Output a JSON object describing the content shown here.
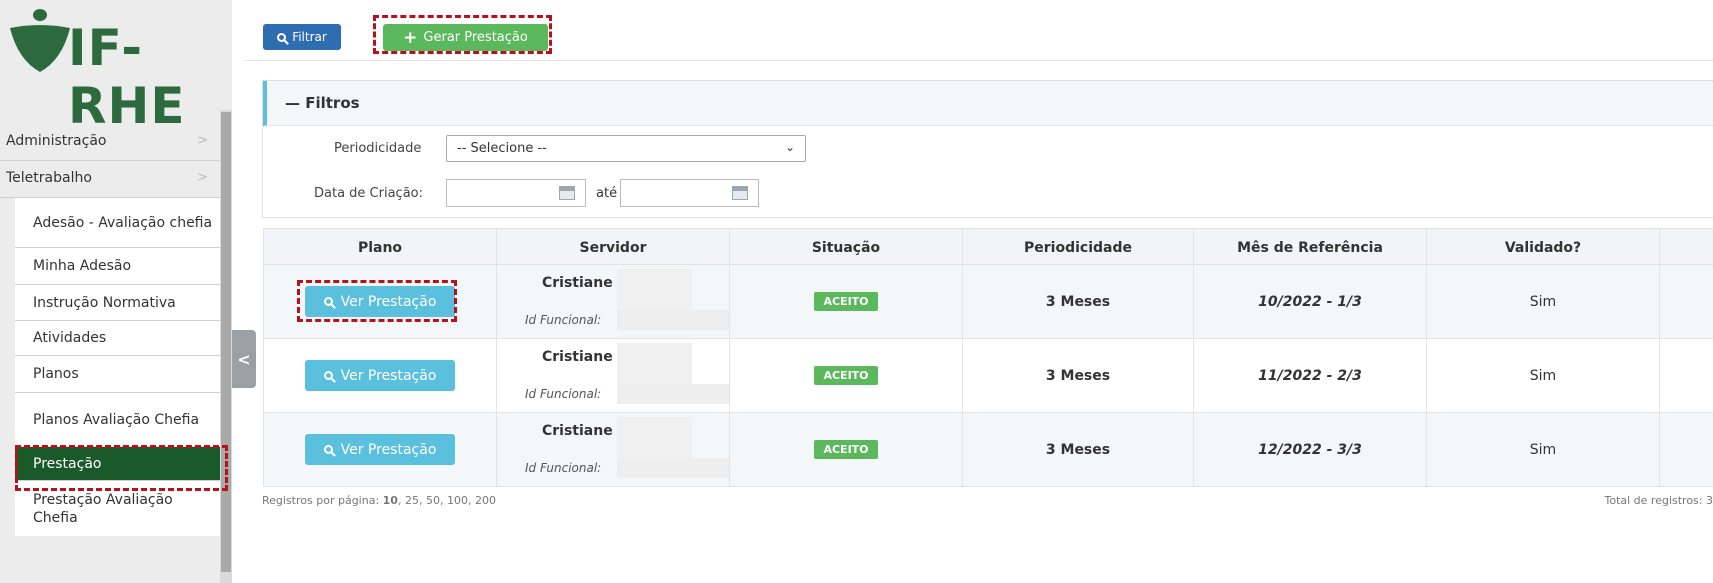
{
  "app": {
    "logo_text": "IF-RHE"
  },
  "sidebar": {
    "top_items": [
      {
        "label": "Administração",
        "chevron": ">"
      },
      {
        "label": "Teletrabalho",
        "chevron": ">"
      }
    ],
    "sub_items": [
      {
        "label": "Adesão - Avaliação chefia"
      },
      {
        "label": "Minha Adesão"
      },
      {
        "label": "Instrução Normativa"
      },
      {
        "label": "Atividades"
      },
      {
        "label": "Planos"
      },
      {
        "label": "Planos Avaliação Chefia"
      },
      {
        "label": "Prestação"
      },
      {
        "label": "Prestação Avaliação Chefia"
      }
    ],
    "collapse_glyph": "<"
  },
  "toolbar": {
    "filter_label": "Filtrar",
    "generate_label": "Gerar Prestação",
    "plus_glyph": "+"
  },
  "filters": {
    "title": "Filtros",
    "collapse_glyph": "—",
    "periodicity_label": "Periodicidade",
    "periodicity_value": "-- Selecione --",
    "creation_date_label": "Data de Criação:",
    "until_label": "até",
    "date_from": "",
    "date_to": ""
  },
  "table": {
    "columns": [
      "Plano",
      "Servidor",
      "Situação",
      "Periodicidade",
      "Mês de Referência",
      "Validado?"
    ],
    "rows": [
      {
        "action": "Ver Prestação",
        "server_name": "Cristiane",
        "server_id_label": "Id Funcional:",
        "status": "ACEITO",
        "periodicity": "3 Meses",
        "month": "10/2022 - 1/3",
        "validated": "Sim"
      },
      {
        "action": "Ver Prestação",
        "server_name": "Cristiane",
        "server_id_label": "Id Funcional:",
        "status": "ACEITO",
        "periodicity": "3 Meses",
        "month": "11/2022 - 2/3",
        "validated": "Sim"
      },
      {
        "action": "Ver Prestação",
        "server_name": "Cristiane",
        "server_id_label": "Id Funcional:",
        "status": "ACEITO",
        "periodicity": "3 Meses",
        "month": "12/2022 - 3/3",
        "validated": "Sim"
      }
    ]
  },
  "footer": {
    "per_page_prefix": "Registros por página:",
    "per_page_options": [
      "10",
      "25",
      "50",
      "100",
      "200"
    ],
    "per_page_selected": "10",
    "total_label": "Total de registros: 3"
  },
  "colors": {
    "brand_green": "#2d6a3e",
    "active_item": "#1a5a2a",
    "primary_blue": "#2e6db0",
    "success_green": "#5cb85c",
    "info_blue": "#5bc0de",
    "highlight_red": "#b5121b"
  }
}
